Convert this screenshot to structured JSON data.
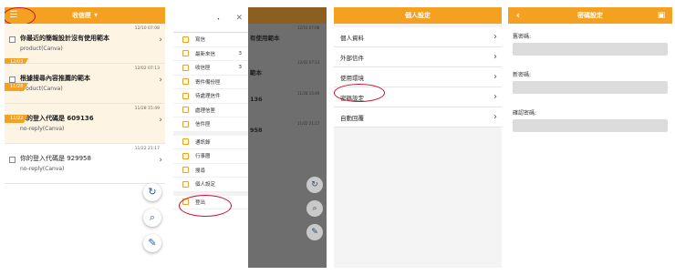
{
  "p1": {
    "title": "收信匣",
    "mails": [
      {
        "subject": "你最近的簡報設計沒有使用範本",
        "from": "product(Canva)",
        "time": "12/10 07:08",
        "unread": true,
        "tag": "12/03"
      },
      {
        "subject": "根據搜尋內容推薦的範本",
        "from": "product(Canva)",
        "time": "12/02 07:13",
        "unread": true,
        "tag": "11/28"
      },
      {
        "subject": "你的登入代碼是 609136",
        "from": "no-reply(Canva)",
        "time": "11/28 15:49",
        "unread": true,
        "tag": "11/22"
      },
      {
        "subject": "你的登入代碼是 929958",
        "from": "no-reply(Canva)",
        "time": "11/22 21:17",
        "unread": false,
        "tag": ""
      }
    ]
  },
  "p2": {
    "drawer_top": "・",
    "items": [
      {
        "label": "寫信",
        "count": ""
      },
      {
        "label": "最新來信",
        "count": "3"
      },
      {
        "label": "收信匣",
        "count": "3"
      },
      {
        "label": "寄件備份匣",
        "count": ""
      },
      {
        "label": "待處理信件",
        "count": ""
      },
      {
        "label": "處理信匣",
        "count": ""
      },
      {
        "label": "信件匣",
        "count": ""
      }
    ],
    "items2": [
      {
        "label": "通訊錄"
      },
      {
        "label": "行事曆"
      },
      {
        "label": "搜尋"
      },
      {
        "label": "個人設定"
      }
    ],
    "logout": "登出",
    "bg_subjects": [
      "有使用範本",
      "範本",
      "136",
      "958"
    ],
    "bg_times": [
      "12/10 07:08",
      "12/02 07:13",
      "11/28 15:49",
      "11/22 21:17"
    ]
  },
  "p3": {
    "title": "個人設定",
    "items": [
      "個人資料",
      "外部信件",
      "使用環境",
      "密碼設定",
      "自動回覆"
    ]
  },
  "p4": {
    "title": "密碼設定",
    "fields": [
      "舊密碼:",
      "新密碼:",
      "確認密碼:"
    ]
  }
}
